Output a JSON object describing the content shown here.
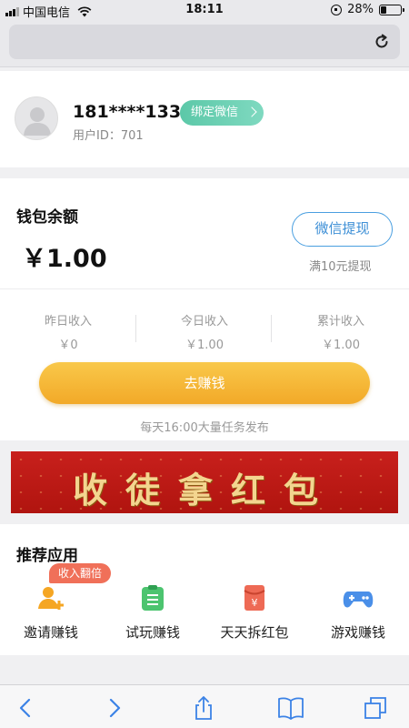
{
  "status_bar": {
    "carrier": "中国电信",
    "time": "18:11",
    "battery": "28%",
    "battery_level": 0.28
  },
  "profile": {
    "phone": "181****1338",
    "bind_wechat_label": "绑定微信",
    "user_id": "用户ID：701"
  },
  "wallet": {
    "title": "钱包余额",
    "balance": "￥1.00",
    "withdraw_label": "微信提现",
    "withdraw_tip": "满10元提现"
  },
  "income": [
    {
      "label": "昨日收入",
      "value": "￥0"
    },
    {
      "label": "今日收入",
      "value": "￥1.00"
    },
    {
      "label": "累计收入",
      "value": "￥1.00"
    }
  ],
  "earn": {
    "button_label": "去赚钱",
    "tip": "每天16:00大量任务发布"
  },
  "banner": {
    "text": "收徒拿红包"
  },
  "apps": {
    "title": "推荐应用",
    "badge": "收入翻倍",
    "items": [
      {
        "label": "邀请赚钱",
        "icon": "add-user-icon",
        "color": "#f5a623"
      },
      {
        "label": "试玩赚钱",
        "icon": "clipboard-icon",
        "color": "#4cc46f"
      },
      {
        "label": "天天拆红包",
        "icon": "red-envelope-icon",
        "color": "#ee6a55"
      },
      {
        "label": "游戏赚钱",
        "icon": "gamepad-icon",
        "color": "#4a8fe8"
      }
    ]
  },
  "colors": {
    "accent_blue": "#3d8fd6",
    "earn_gradient": "#f2a928",
    "bind_green": "#5cc8a8"
  }
}
